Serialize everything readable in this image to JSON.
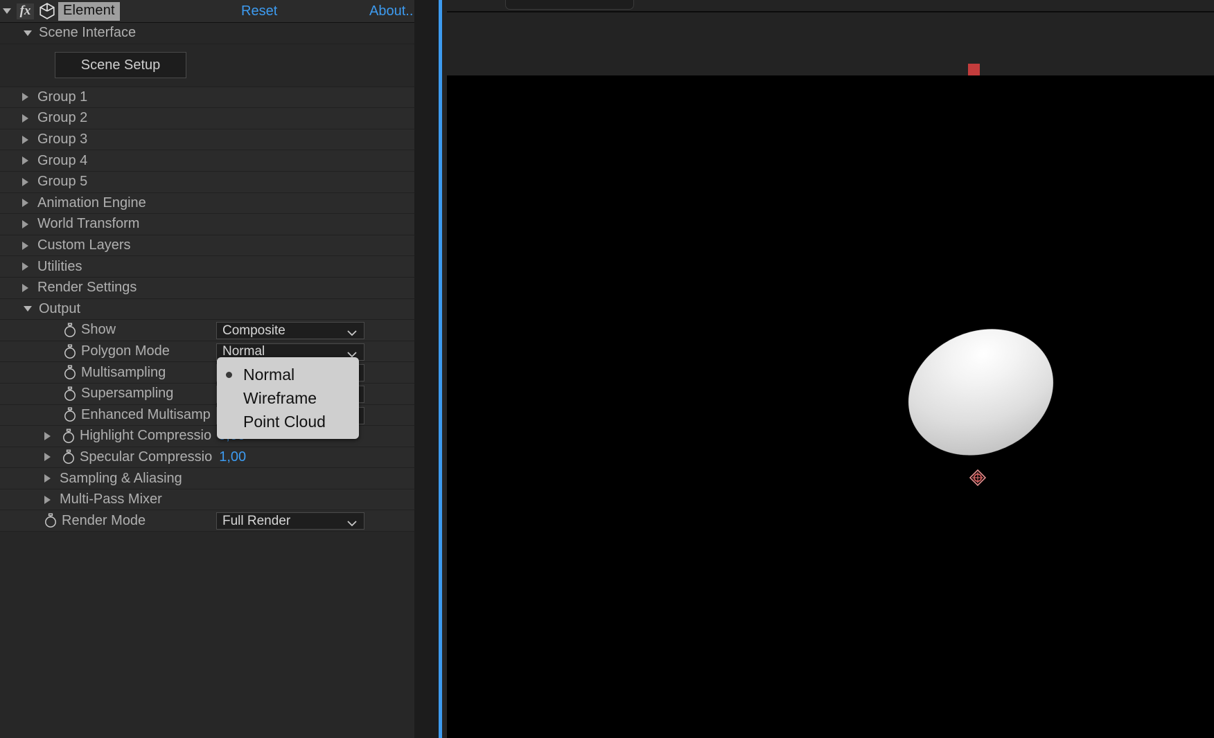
{
  "app": {
    "panel_title": "Element",
    "fx_badge": "fx",
    "reset_label": "Reset",
    "about_label": "About..",
    "accent_blue": "#3d9bf0",
    "panel_bg": "#272727",
    "popup_bg": "#cfcfcf"
  },
  "scene_interface": {
    "section_label": "Scene Interface",
    "scene_setup_button": "Scene Setup"
  },
  "groups": [
    {
      "label": "Group 1"
    },
    {
      "label": "Group 2"
    },
    {
      "label": "Group 3"
    },
    {
      "label": "Group 4"
    },
    {
      "label": "Group 5"
    },
    {
      "label": "Animation Engine"
    },
    {
      "label": "World Transform"
    },
    {
      "label": "Custom Layers"
    },
    {
      "label": "Utilities"
    },
    {
      "label": "Render Settings"
    }
  ],
  "output": {
    "section_label": "Output",
    "properties": [
      {
        "label": "Show",
        "type": "dropdown",
        "value": "Composite"
      },
      {
        "label": "Polygon Mode",
        "type": "dropdown",
        "value": "Normal"
      },
      {
        "label": "Multisampling",
        "type": "dropdown",
        "value": ""
      },
      {
        "label": "Supersampling",
        "type": "dropdown",
        "value": ""
      },
      {
        "label": "Enhanced Multisamp",
        "type": "dropdown",
        "value": ""
      },
      {
        "label": "Highlight Compressio",
        "type": "number",
        "value": "0,00"
      },
      {
        "label": "Specular Compressio",
        "type": "number",
        "value": "1,00"
      }
    ],
    "subsections": [
      {
        "label": "Sampling & Aliasing"
      },
      {
        "label": "Multi-Pass Mixer"
      }
    ],
    "render_mode": {
      "label": "Render Mode",
      "value": "Full Render"
    }
  },
  "polygon_mode_popup": {
    "open": true,
    "selected": "Normal",
    "items": [
      {
        "label": "Normal"
      },
      {
        "label": "Wireframe"
      },
      {
        "label": "Point Cloud"
      }
    ]
  },
  "viewport": {
    "background": "#000000",
    "red_marker_color": "#c33c3c",
    "anchor_point_color": "#d06b6b",
    "object": "sphere"
  }
}
